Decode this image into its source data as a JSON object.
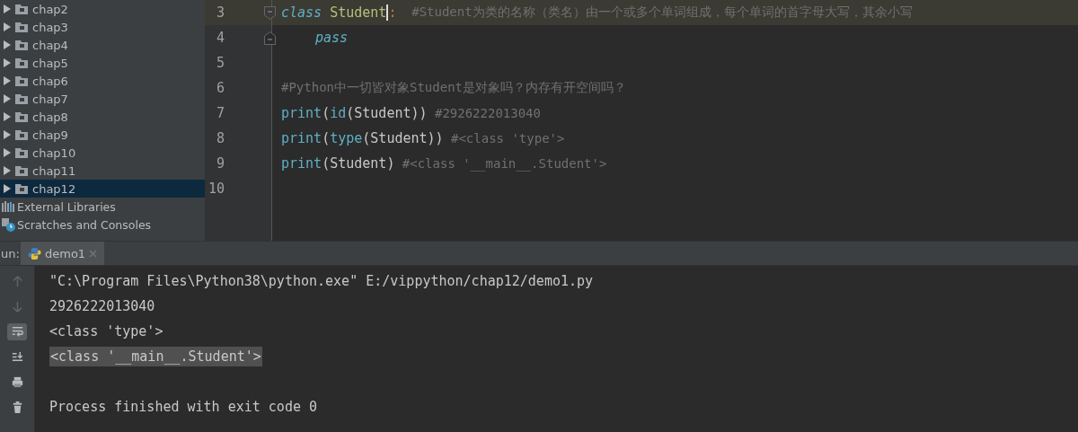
{
  "project_tree": {
    "items": [
      {
        "label": "chap2",
        "selected": false
      },
      {
        "label": "chap3",
        "selected": false
      },
      {
        "label": "chap4",
        "selected": false
      },
      {
        "label": "chap5",
        "selected": false
      },
      {
        "label": "chap6",
        "selected": false
      },
      {
        "label": "chap7",
        "selected": false
      },
      {
        "label": "chap8",
        "selected": false
      },
      {
        "label": "chap9",
        "selected": false
      },
      {
        "label": "chap10",
        "selected": false
      },
      {
        "label": "chap11",
        "selected": false
      },
      {
        "label": "chap12",
        "selected": true
      }
    ],
    "extras": [
      {
        "kind": "libraries",
        "label": "External Libraries"
      },
      {
        "kind": "scratches",
        "label": "Scratches and Consoles"
      }
    ]
  },
  "editor": {
    "lines": [
      {
        "number": "3",
        "current": true,
        "kind": "foldstart",
        "tokens": [
          {
            "kind": "keyword",
            "text": "class"
          },
          {
            "kind": "classname",
            "text": "Student"
          },
          {
            "kind": "punct",
            "text": ":"
          },
          {
            "kind": "comment",
            "text": "#Student为类的名称（类名）由一个或多个单词组成，每个单词的首字母大写，其余小写"
          }
        ]
      },
      {
        "number": "4",
        "current": false,
        "kind": "foldend",
        "tokens": [
          {
            "kind": "keyword",
            "text": "pass"
          }
        ]
      },
      {
        "number": "5",
        "current": false,
        "kind": "plain"
      },
      {
        "number": "6",
        "current": false,
        "kind": "plain",
        "tokens": [
          {
            "kind": "comment",
            "text": "#Python中一切皆对象Student是对象吗？内存有开空间吗？"
          }
        ]
      },
      {
        "number": "7",
        "current": false,
        "kind": "plain",
        "tokens": [
          {
            "kind": "builtin",
            "text": "print"
          },
          {
            "kind": "plain",
            "text": "("
          },
          {
            "kind": "builtin",
            "text": "id"
          },
          {
            "kind": "plain",
            "text": "(Student))"
          },
          {
            "kind": "comment",
            "text": "#2926222013040"
          }
        ]
      },
      {
        "number": "8",
        "current": false,
        "kind": "plain",
        "tokens": [
          {
            "kind": "builtin",
            "text": "print"
          },
          {
            "kind": "plain",
            "text": "("
          },
          {
            "kind": "builtin",
            "text": "type"
          },
          {
            "kind": "plain",
            "text": "(Student))"
          },
          {
            "kind": "comment",
            "text": "#<class 'type'>"
          }
        ]
      },
      {
        "number": "9",
        "current": false,
        "kind": "plain",
        "tokens": [
          {
            "kind": "builtin",
            "text": "print"
          },
          {
            "kind": "plain",
            "text": "(Student)"
          },
          {
            "kind": "comment",
            "text": "#<class '__main__.Student'>"
          }
        ]
      },
      {
        "number": "10",
        "current": false,
        "kind": "plain"
      }
    ]
  },
  "run_panel": {
    "label": "un:",
    "tabs": [
      {
        "label": "demo1",
        "selected": true
      }
    ],
    "toolbar": [
      {
        "kind": "up",
        "on": false
      },
      {
        "kind": "down",
        "on": false
      },
      {
        "kind": "wrap",
        "on": true
      },
      {
        "kind": "scroll-end",
        "on": false
      },
      {
        "kind": "print",
        "on": false
      },
      {
        "kind": "trash",
        "on": false
      }
    ],
    "output": [
      {
        "text": "\"C:\\Program Files\\Python38\\python.exe\" E:/vippython/chap12/demo1.py",
        "selected": false
      },
      {
        "text": "2926222013040",
        "selected": false
      },
      {
        "text": "<class 'type'>",
        "selected": false
      },
      {
        "text": "<class '__main__.Student'>",
        "selected": true
      },
      {
        "text": "Process finished with exit code 0",
        "selected": false
      }
    ]
  }
}
